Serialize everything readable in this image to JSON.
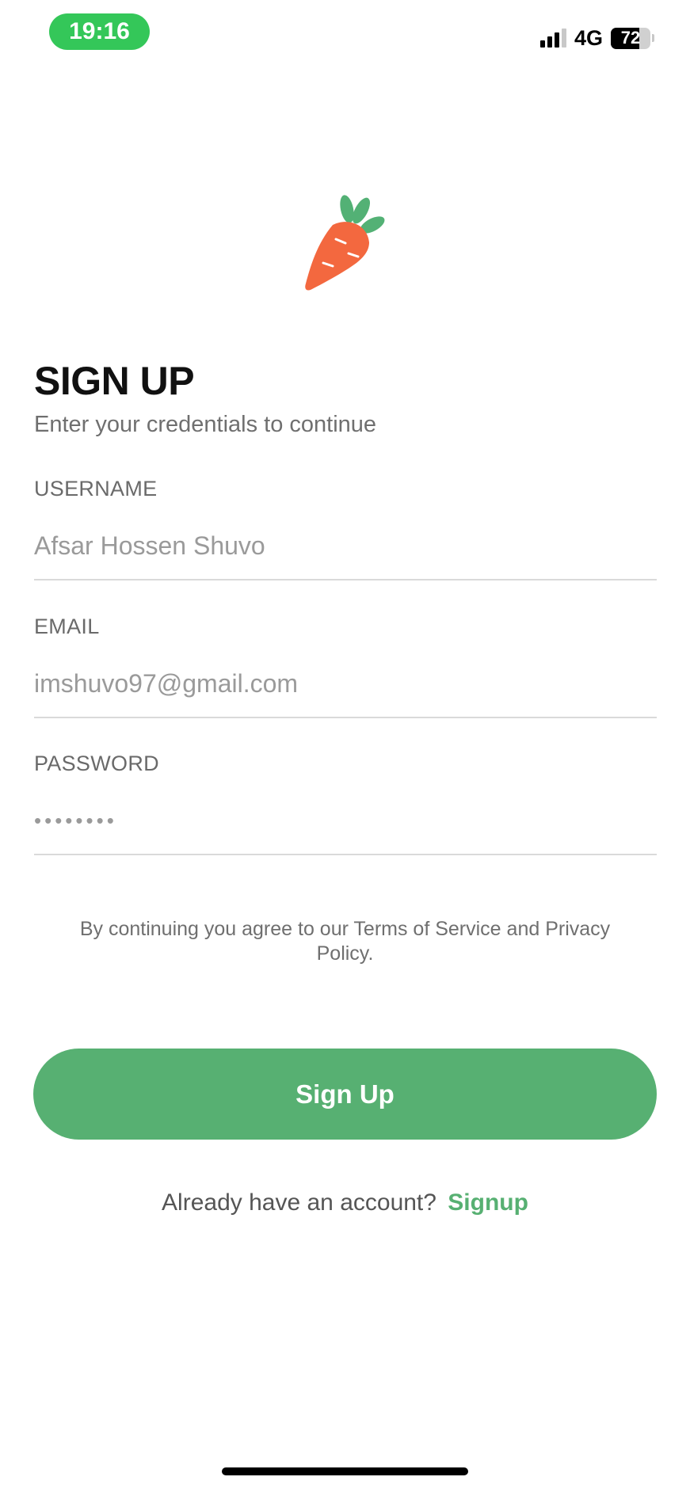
{
  "status_bar": {
    "time": "19:16",
    "network": "4G",
    "battery_level": "72",
    "battery_fraction": 0.72
  },
  "logo": {
    "icon": "carrot-icon",
    "colors": {
      "body": "#f3683f",
      "leaves": "#53b175"
    }
  },
  "form": {
    "title": "SIGN UP",
    "subtitle": "Enter your credentials to continue",
    "username": {
      "label": "USERNAME",
      "value": "Afsar Hossen Shuvo"
    },
    "email": {
      "label": "EMAIL",
      "value": "imshuvo97@gmail.com"
    },
    "password": {
      "label": "PASSWORD",
      "masked_value": "••••••••"
    }
  },
  "terms_text": "By continuing you agree to our Terms of Service and Privacy Policy.",
  "signup_button_label": "Sign Up",
  "account_prompt": {
    "text": "Already have an account?",
    "link_label": "Signup"
  },
  "colors": {
    "accent": "#57b072",
    "status_pill": "#34c759"
  }
}
